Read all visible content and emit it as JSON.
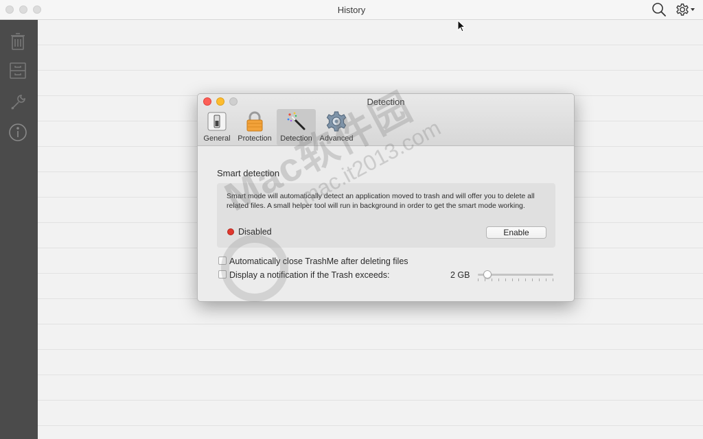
{
  "window": {
    "title": "History",
    "icons": {
      "search": "search-icon",
      "settings": "gear-icon"
    }
  },
  "sidebar": {
    "items": [
      {
        "name": "trash-icon"
      },
      {
        "name": "archive-icon"
      },
      {
        "name": "wrench-icon"
      },
      {
        "name": "info-icon"
      }
    ]
  },
  "dialog": {
    "title": "Detection",
    "tabs": [
      {
        "label": "General",
        "icon": "general-switch-icon",
        "active": false
      },
      {
        "label": "Protection",
        "icon": "padlock-icon",
        "active": false
      },
      {
        "label": "Detection",
        "icon": "magic-wand-icon",
        "active": true
      },
      {
        "label": "Advanced",
        "icon": "gear-icon",
        "active": false
      }
    ],
    "smart_detection": {
      "title": "Smart detection",
      "description": "Smart mode will automatically detect an application moved to trash and will offer you to delete all related files. A small helper tool will run in background in order to get the smart mode working.",
      "status": "Disabled",
      "status_color": "#e0382e",
      "enable_label": "Enable"
    },
    "options": {
      "auto_close_label": "Automatically close TrashMe after deleting files",
      "auto_close_checked": false,
      "notify_label": "Display a notification if the Trash exceeds:",
      "notify_checked": false,
      "size_value": "2 GB",
      "slider_level": 0.1,
      "slider_ticks": 12
    }
  },
  "watermark": {
    "line1": "Mac软件园",
    "line2": "mac.it2013.com"
  }
}
